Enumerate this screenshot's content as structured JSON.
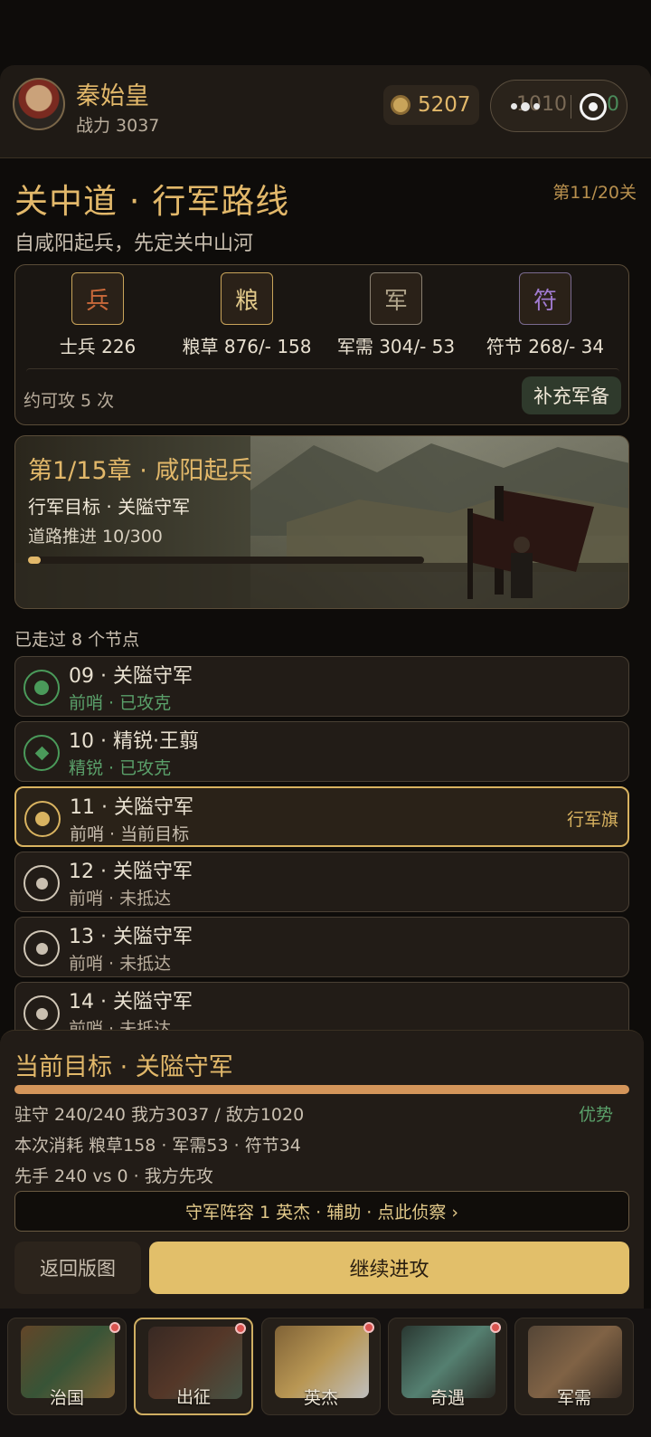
{
  "player": {
    "name": "秦始皇",
    "power_label": "战力 3037"
  },
  "currency": {
    "coins": "5207",
    "capsule_left": "1010",
    "capsule_right": "0"
  },
  "route": {
    "title": "关中道 · 行军路线",
    "stage": "第11/20关",
    "subtitle": "自咸阳起兵，先定关中山河"
  },
  "resources": [
    {
      "icon": "兵",
      "label": "士兵 226",
      "icon_name": "soldier-icon"
    },
    {
      "icon": "粮",
      "label": "粮草 876/- 158",
      "icon_name": "grain-icon"
    },
    {
      "icon": "军",
      "label": "军需 304/- 53",
      "icon_name": "supply-icon"
    },
    {
      "icon": "符",
      "label": "符节 268/- 34",
      "icon_name": "tally-icon"
    }
  ],
  "attacks_left": "约可攻 5 次",
  "refill_label": "补充军备",
  "chapter": {
    "title": "第1/15章 · 咸阳起兵",
    "goal": "行军目标 · 关隘守军",
    "progress_text": "道路推进 10/300",
    "progress": 0.033
  },
  "walked": "已走过 8 个节点",
  "nodes": [
    {
      "title": "09 · 关隘守军",
      "sub": "前哨 · 已攻克",
      "state": "done"
    },
    {
      "title": "10 · 精锐·王翦",
      "sub": "精锐 · 已攻克",
      "state": "elite"
    },
    {
      "title": "11 · 关隘守军",
      "sub": "前哨 · 当前目标",
      "state": "current",
      "flag": "行军旗"
    },
    {
      "title": "12 · 关隘守军",
      "sub": "前哨 · 未抵达",
      "state": "locked"
    },
    {
      "title": "13 · 关隘守军",
      "sub": "前哨 · 未抵达",
      "state": "locked"
    },
    {
      "title": "14 · 关隘守军",
      "sub": "前哨 · 未抵达",
      "state": "locked"
    }
  ],
  "target": {
    "title": "当前目标 · 关隘守军",
    "garrison": "驻守 240/240 我方3037 / 敌方1020",
    "advantage": "优势",
    "cost": "本次消耗 粮草158 · 军需53 · 符节34",
    "initiative": "先手 240 vs 0 · 我方先攻",
    "scout": "守军阵容 1 英杰 · 辅助 · 点此侦察 ›",
    "back": "返回版图",
    "go": "继续进攻"
  },
  "tabs": [
    {
      "label": "治国",
      "badge": true,
      "selected": false
    },
    {
      "label": "出征",
      "badge": true,
      "selected": true
    },
    {
      "label": "英杰",
      "badge": true,
      "selected": false
    },
    {
      "label": "奇遇",
      "badge": true,
      "selected": false
    },
    {
      "label": "军需",
      "badge": false,
      "selected": false
    }
  ]
}
